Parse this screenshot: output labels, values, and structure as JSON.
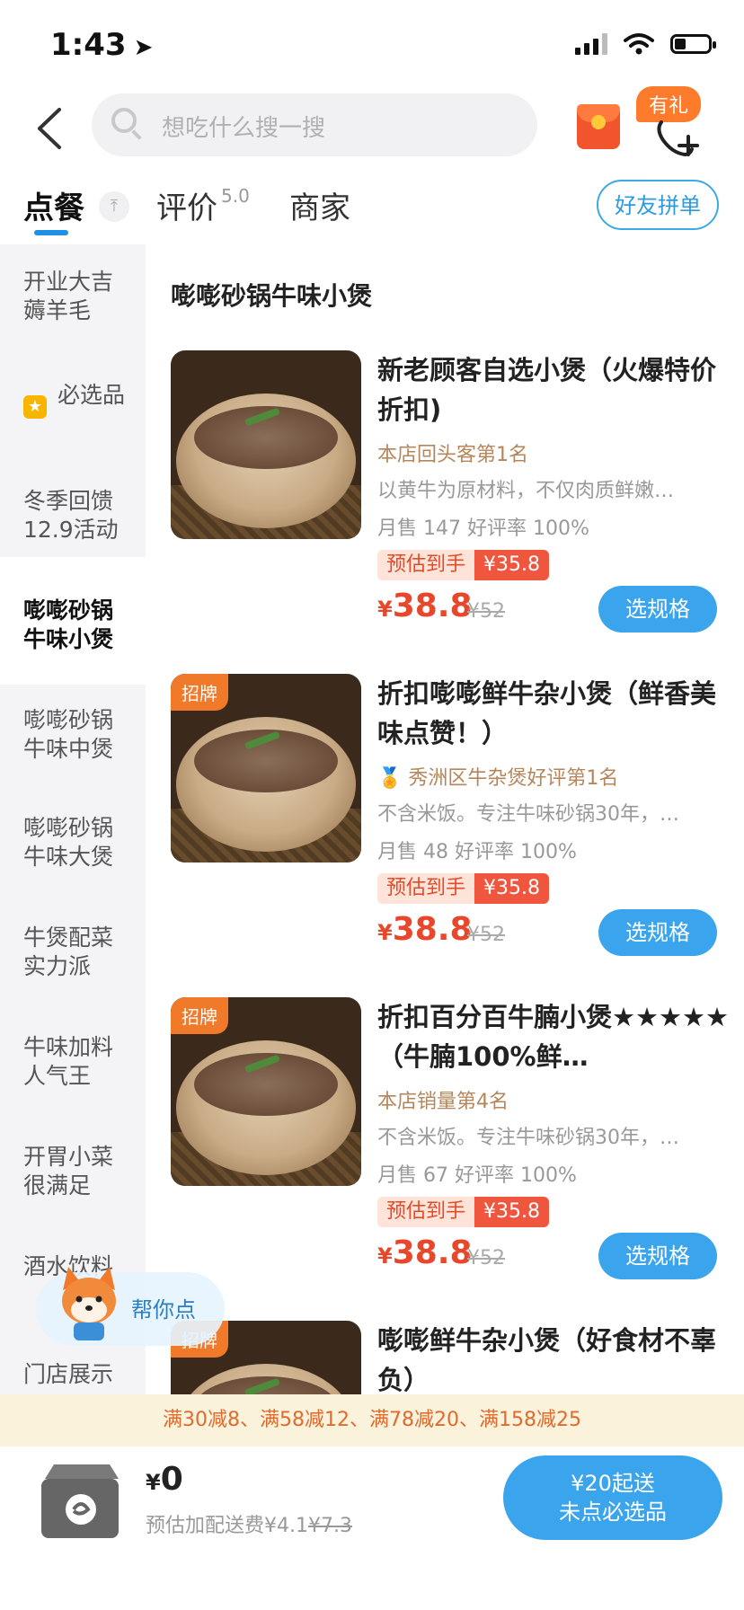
{
  "status_bar": {
    "time": "1:43"
  },
  "search": {
    "placeholder": "想吃什么搜一搜"
  },
  "header": {
    "gift_badge": "有礼"
  },
  "tabs": {
    "order": "点餐",
    "review": "评价",
    "rating": "5.0",
    "merchant": "商家",
    "friend_order": "好友拼单"
  },
  "sidebar": {
    "items": [
      "开业大吉薅羊毛",
      "必选品",
      "冬季回馈12.9活动",
      "嘭嘭砂锅牛味小煲",
      "嘭嘭砂锅牛味中煲",
      "嘭嘭砂锅牛味大煲",
      "牛煲配菜实力派",
      "牛味加料人气王",
      "开胃小菜很满足",
      "酒水饮料",
      "门店展示"
    ]
  },
  "section_title": "嘭嘭砂锅牛味小煲",
  "dishes": [
    {
      "name": "新老顾客自选小煲（火爆特价折扣)",
      "badge": "",
      "rank": "本店回头客第1名",
      "desc": "以黄牛为原材料，不仅肉质鲜嫩…",
      "sales": "月售 147 好评率 100%",
      "est_label": "预估到手",
      "est_price": "¥35.8",
      "price": "38.8",
      "orig": "¥52",
      "spec": "选规格"
    },
    {
      "name": "折扣嘭嘭鲜牛杂小煲（鲜香美味点赞！）",
      "badge": "招牌",
      "rank": "秀洲区牛杂煲好评第1名",
      "desc": "不含米饭。专注牛味砂锅30年，…",
      "sales": "月售 48 好评率 100%",
      "est_label": "预估到手",
      "est_price": "¥35.8",
      "price": "38.8",
      "orig": "¥52",
      "spec": "选规格"
    },
    {
      "name": "折扣百分百牛腩小煲★★★★★（牛腩100%鲜…",
      "badge": "招牌",
      "rank": "本店销量第4名",
      "desc": "不含米饭。专注牛味砂锅30年，…",
      "sales": "月售 67 好评率 100%",
      "est_label": "预估到手",
      "est_price": "¥35.8",
      "price": "38.8",
      "orig": "¥52",
      "spec": "选规格"
    },
    {
      "name": "嘭嘭鲜牛杂小煲（好食材不辜负）",
      "badge": "招牌"
    }
  ],
  "helper": {
    "label": "帮你点"
  },
  "discount": "满30减8、满58减12、满78减20、满158减25",
  "bottom": {
    "currency": "¥",
    "total": "0",
    "fee_label": "预估加配送费¥4.1",
    "fee_orig": "¥7.3",
    "checkout_line1": "¥20起送",
    "checkout_line2": "未点必选品"
  },
  "colors": {
    "accent": "#3aa4ec",
    "price": "#e8472c",
    "badge": "#f07a2a"
  }
}
